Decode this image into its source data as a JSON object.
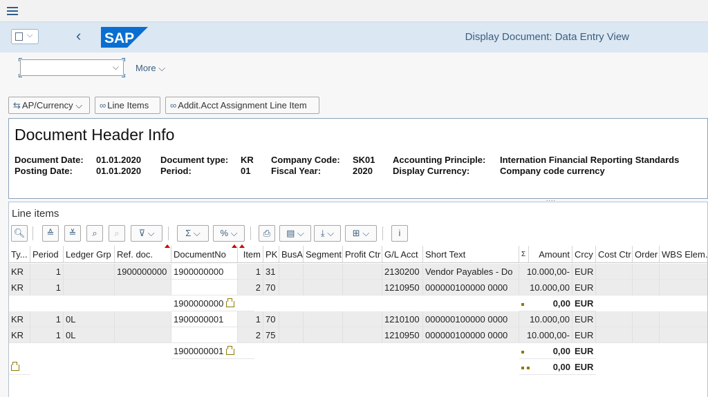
{
  "shell": {
    "title": "Display Document: Data Entry View",
    "more_label": "More",
    "combo_value": ""
  },
  "actions": {
    "ap_currency": "AP/Currency",
    "line_items": "Line Items",
    "addit_acct": "Addit.Acct Assignment Line Item"
  },
  "header": {
    "title": "Document Header Info",
    "fields": {
      "document_date_label": "Document Date:",
      "document_date": "01.01.2020",
      "posting_date_label": "Posting Date:",
      "posting_date": "01.01.2020",
      "document_type_label": "Document type:",
      "document_type": "KR",
      "period_label": "Period:",
      "period": "01",
      "company_code_label": "Company Code:",
      "company_code": "SK01",
      "fiscal_year_label": "Fiscal Year:",
      "fiscal_year": "2020",
      "accounting_principle_label": "Accounting Principle:",
      "accounting_principle": "Internation Financial Reporting Standards",
      "display_currency_label": "Display Currency:",
      "display_currency": "Company code currency"
    }
  },
  "splitter": "....",
  "line_items": {
    "title": "Line items",
    "toolbar": {
      "sigma": "Σ",
      "subtotal": "%",
      "info": "i"
    },
    "columns": [
      "Ty...",
      "Period",
      "Ledger Grp",
      "Ref. doc.",
      "DocumentNo",
      "Item",
      "PK",
      "BusA",
      "Segment",
      "Profit Ctr",
      "G/L Acct",
      "Short Text",
      "Σ",
      "Amount",
      "Crcy",
      "Cost Ctr",
      "Order",
      "WBS Elem."
    ],
    "rows": [
      {
        "type": "KR",
        "period": "1",
        "ledger": "",
        "refdoc": "1900000000",
        "docno": "1900000000",
        "item": "1",
        "pk": "31",
        "gl": "2130200",
        "text": "Vendor Payables - Do",
        "amount": "10.000,00-",
        "crcy": "EUR"
      },
      {
        "type": "KR",
        "period": "1",
        "ledger": "",
        "refdoc": "",
        "docno": "",
        "item": "2",
        "pk": "70",
        "gl": "1210950",
        "text": "000000100000 0000",
        "amount": "10.000,00",
        "crcy": "EUR"
      },
      {
        "subtotal_doc": "1900000000",
        "amount": "0,00",
        "crcy": "EUR"
      },
      {
        "type": "KR",
        "period": "1",
        "ledger": "0L",
        "refdoc": "",
        "docno": "1900000001",
        "item": "1",
        "pk": "70",
        "gl": "1210100",
        "text": "000000100000 0000",
        "amount": "10.000,00",
        "crcy": "EUR"
      },
      {
        "type": "KR",
        "period": "1",
        "ledger": "0L",
        "refdoc": "",
        "docno": "",
        "item": "2",
        "pk": "75",
        "gl": "1210950",
        "text": "000000100000 0000",
        "amount": "10.000,00-",
        "crcy": "EUR"
      },
      {
        "subtotal_doc": "1900000001",
        "amount": "0,00",
        "crcy": "EUR"
      },
      {
        "total": true,
        "amount": "0,00",
        "crcy": "EUR"
      }
    ]
  },
  "colors": {
    "shell_bg": "#dbe7f2",
    "sap_blue": "#0a6ed1",
    "accent": "#2e5d8a"
  }
}
